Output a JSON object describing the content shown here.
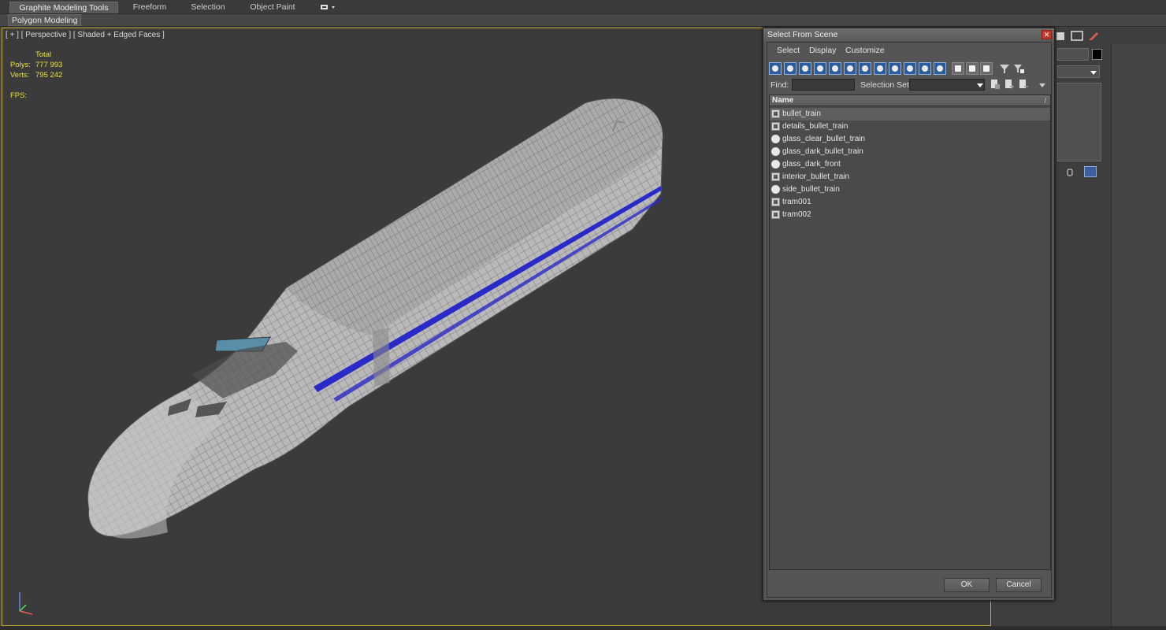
{
  "ribbon": {
    "tabs": [
      {
        "label": "Graphite Modeling Tools",
        "active": true
      },
      {
        "label": "Freeform",
        "active": false
      },
      {
        "label": "Selection",
        "active": false
      },
      {
        "label": "Object Paint",
        "active": false
      }
    ],
    "sub_label": "Polygon Modeling"
  },
  "viewport": {
    "label": "[ + ] [ Perspective ] [ Shaded + Edged Faces ]",
    "stats": {
      "total_label": "Total",
      "polys_label": "Polys:",
      "polys_value": "777 993",
      "verts_label": "Verts:",
      "verts_value": "795 242",
      "fps_label": "FPS:"
    },
    "mesh_accent_color": "#2a2ac8",
    "border_color": "#c7a93a"
  },
  "dialog": {
    "title": "Select From Scene",
    "close_glyph": "✕",
    "menu": [
      "Select",
      "Display",
      "Customize"
    ],
    "find_label": "Find:",
    "find_value": "",
    "selection_set_label": "Selection Set:",
    "selection_set_value": "",
    "list_header": "Name",
    "sort_glyph": "/",
    "objects": [
      {
        "name": "bullet_train",
        "icon": "object-icon",
        "selected": true
      },
      {
        "name": "details_bullet_train",
        "icon": "object-icon",
        "selected": false
      },
      {
        "name": "glass_clear_bullet_train",
        "icon": "sphere-icon",
        "selected": false
      },
      {
        "name": "glass_dark_bullet_train",
        "icon": "sphere-icon",
        "selected": false
      },
      {
        "name": "glass_dark_front",
        "icon": "sphere-icon",
        "selected": false
      },
      {
        "name": "interior_bullet_train",
        "icon": "object-icon",
        "selected": false
      },
      {
        "name": "side_bullet_train",
        "icon": "sphere-icon",
        "selected": false
      },
      {
        "name": "tram001",
        "icon": "object-icon",
        "selected": false
      },
      {
        "name": "tram002",
        "icon": "object-icon",
        "selected": false
      }
    ],
    "ok_label": "OK",
    "cancel_label": "Cancel"
  }
}
